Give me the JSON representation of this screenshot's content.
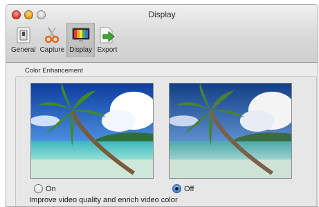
{
  "window": {
    "title": "Display"
  },
  "toolbar": {
    "items": [
      {
        "label": "General",
        "icon": "switch-icon"
      },
      {
        "label": "Capture",
        "icon": "scissors-icon"
      },
      {
        "label": "Display",
        "icon": "monitor-icon",
        "selected": true
      },
      {
        "label": "Export",
        "icon": "export-arrow-icon"
      }
    ]
  },
  "color_enhancement": {
    "group_label": "Color Enhancement",
    "options": [
      {
        "label": "On",
        "selected": false
      },
      {
        "label": "Off",
        "selected": true
      }
    ],
    "hint": "Improve video quality and enrich video color"
  },
  "colors": {
    "accent_radio": "#4b8fe0",
    "export_arrow": "#3da532"
  }
}
